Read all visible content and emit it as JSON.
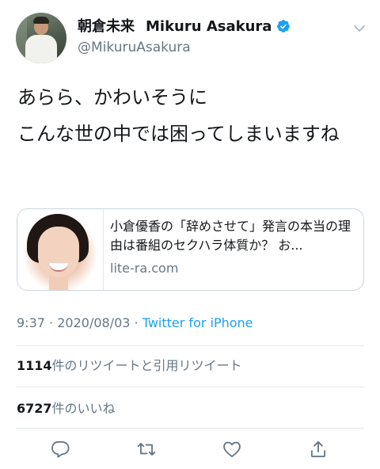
{
  "author": {
    "display_name_jp": "朝倉未来",
    "display_name_en": "Mikuru Asakura",
    "handle": "@MikuruAsakura",
    "verified": true
  },
  "tweet": {
    "line1": "あらら、かわいそうに",
    "line2": "こんな世の中では困ってしまいますね"
  },
  "link_card": {
    "title": "小倉優香の「辞めさせて」発言の本当の理由は番組のセクハラ体質か？ お...",
    "domain": "lite-ra.com"
  },
  "meta": {
    "time": "9:37",
    "separator": "·",
    "date": "2020/08/03",
    "source": "Twitter for iPhone"
  },
  "stats": {
    "retweets_count": "1114",
    "retweets_label": "件のリツイートと引用リツイート",
    "likes_count": "6727",
    "likes_label": "件のいいね"
  },
  "colors": {
    "link": "#1da1f2",
    "secondary_text": "#657786",
    "divider": "#e1e8ed"
  },
  "icons": [
    "verified-badge-icon",
    "chevron-down-icon",
    "reply-icon",
    "retweet-icon",
    "like-icon",
    "share-icon"
  ]
}
